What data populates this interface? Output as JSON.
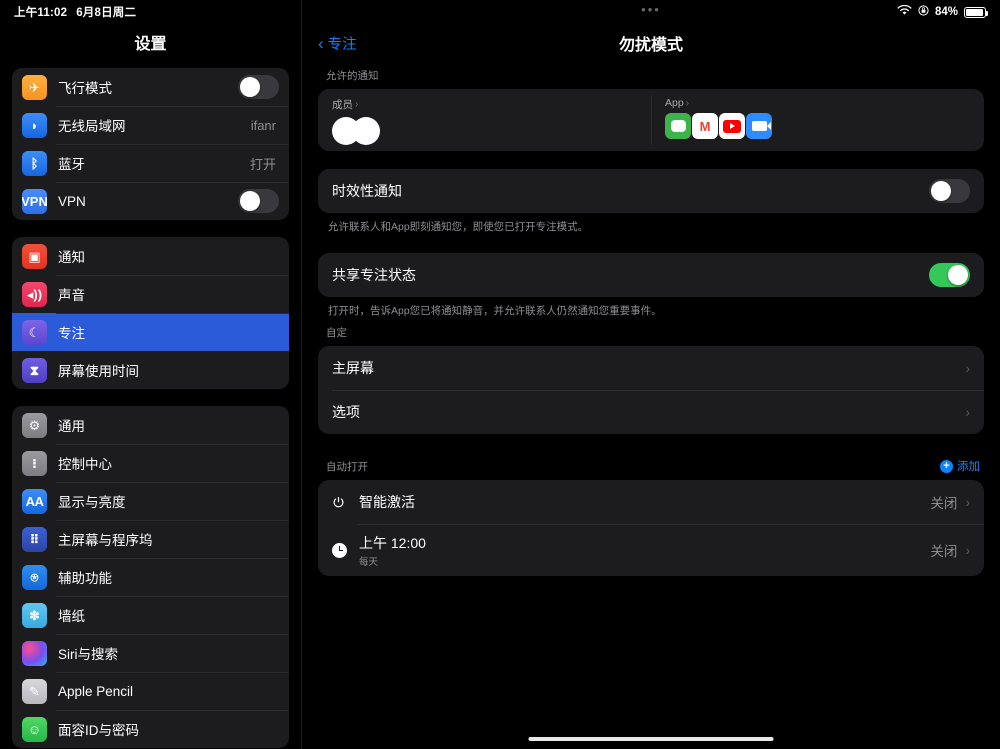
{
  "status_bar": {
    "time": "上午11:02",
    "date": "6月8日周二",
    "wifi_icon": "wifi-icon",
    "lock_icon": "rotation-lock-icon",
    "battery_percent": "84%",
    "battery_icon": "battery-icon"
  },
  "sidebar": {
    "title": "设置",
    "groups": [
      {
        "items": [
          {
            "label": "飞行模式",
            "icon": "airplane-icon",
            "glyph": "✈",
            "icon_class": "ic-plane",
            "control": "toggle",
            "toggle_on": false
          },
          {
            "label": "无线局域网",
            "icon": "wifi-icon",
            "glyph": "◗",
            "icon_class": "ic-wifi",
            "control": "value",
            "value": "ifanr"
          },
          {
            "label": "蓝牙",
            "icon": "bluetooth-icon",
            "glyph": "ᛒ",
            "icon_class": "ic-bt",
            "control": "value",
            "value": "打开"
          },
          {
            "label": "VPN",
            "icon": "vpn-icon",
            "glyph": "VPN",
            "icon_class": "ic-vpn",
            "control": "toggle",
            "toggle_on": false
          }
        ]
      },
      {
        "items": [
          {
            "label": "通知",
            "icon": "notifications-icon",
            "glyph": "▣",
            "icon_class": "ic-noti",
            "control": "none"
          },
          {
            "label": "声音",
            "icon": "sound-icon",
            "glyph": "◂))",
            "icon_class": "ic-sound",
            "control": "none"
          },
          {
            "label": "专注",
            "icon": "moon-icon",
            "glyph": "☾",
            "icon_class": "ic-focus",
            "control": "none",
            "selected": true
          },
          {
            "label": "屏幕使用时间",
            "icon": "hourglass-icon",
            "glyph": "⧗",
            "icon_class": "ic-screen",
            "control": "none"
          }
        ]
      },
      {
        "items": [
          {
            "label": "通用",
            "icon": "gear-icon",
            "glyph": "⚙",
            "icon_class": "ic-gen",
            "control": "none"
          },
          {
            "label": "控制中心",
            "icon": "control-center-icon",
            "glyph": "⁝",
            "icon_class": "ic-cc",
            "control": "none"
          },
          {
            "label": "显示与亮度",
            "icon": "display-brightness-icon",
            "glyph": "AA",
            "icon_class": "ic-disp",
            "control": "none"
          },
          {
            "label": "主屏幕与程序坞",
            "icon": "home-screen-dock-icon",
            "glyph": "⠿",
            "icon_class": "ic-home",
            "control": "none"
          },
          {
            "label": "辅助功能",
            "icon": "accessibility-icon",
            "glyph": "⍟",
            "icon_class": "ic-acc",
            "control": "none"
          },
          {
            "label": "墙纸",
            "icon": "wallpaper-icon",
            "glyph": "✽",
            "icon_class": "ic-wall",
            "control": "none"
          },
          {
            "label": "Siri与搜索",
            "icon": "siri-icon",
            "glyph": "",
            "icon_class": "ic-siri",
            "control": "none"
          },
          {
            "label": "Apple Pencil",
            "icon": "apple-pencil-icon",
            "glyph": "✎",
            "icon_class": "ic-pencil",
            "control": "none"
          },
          {
            "label": "面容ID与密码",
            "icon": "face-id-icon",
            "glyph": "☺",
            "icon_class": "ic-faceid",
            "control": "none"
          }
        ]
      }
    ]
  },
  "detail": {
    "multitask_dots": "•••",
    "back_label": "专注",
    "back_icon": "chevron-left-icon",
    "title": "勿扰模式",
    "allowed_section": {
      "header": "允许的通知",
      "people": {
        "label": "成员",
        "chevron": "›",
        "avatar_count": 2
      },
      "apps": {
        "label": "App",
        "chevron": "›",
        "icons": [
          {
            "name": "wechat-app-icon",
            "class": "app-wechat"
          },
          {
            "name": "gmail-app-icon",
            "class": "app-gmail",
            "glyph": "M"
          },
          {
            "name": "youtube-app-icon",
            "class": "app-youtube"
          },
          {
            "name": "zoom-app-icon",
            "class": "app-zoom"
          }
        ]
      }
    },
    "time_sensitive": {
      "label": "时效性通知",
      "toggle_on": false,
      "footer": "允许联系人和App即刻通知您，即使您已打开专注模式。"
    },
    "share_focus": {
      "label": "共享专注状态",
      "toggle_on": true,
      "footer": "打开时，告诉App您已将通知静音，并允许联系人仍然通知您重要事件。"
    },
    "custom_section": {
      "header": "自定",
      "rows": [
        {
          "label": "主屏幕",
          "chevron": "›"
        },
        {
          "label": "选项",
          "chevron": "›"
        }
      ]
    },
    "auto_section": {
      "header": "自动打开",
      "add_label": "添加",
      "add_icon": "plus-circle-icon",
      "rows": [
        {
          "label": "智能激活",
          "sub": "",
          "value": "关闭",
          "chevron": "›",
          "icon": "power-icon",
          "glyph": "⏻"
        },
        {
          "label": "上午 12:00",
          "sub": "每天",
          "value": "关闭",
          "chevron": "›",
          "icon": "clock-icon",
          "glyph": ""
        }
      ]
    }
  }
}
